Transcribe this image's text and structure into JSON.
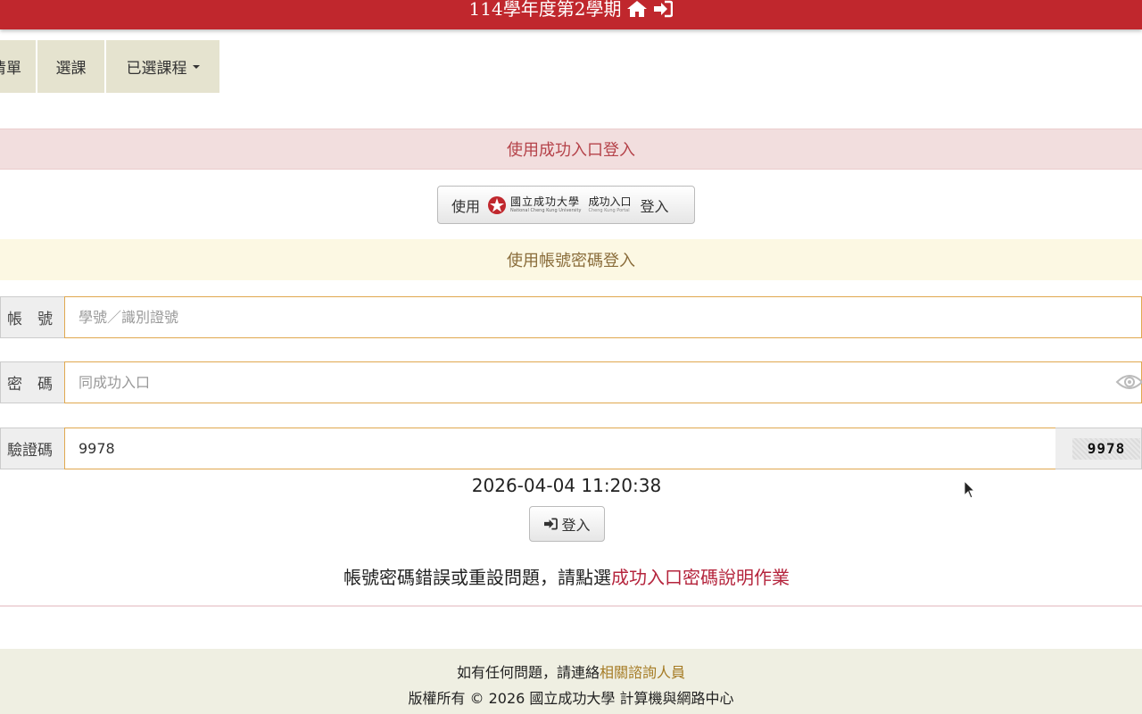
{
  "header": {
    "title": "114學年度第2學期",
    "icons": [
      "home-icon",
      "sign-in-icon"
    ]
  },
  "nav": {
    "items": [
      {
        "label": "清單"
      },
      {
        "label": "選課"
      },
      {
        "label": "已選課程"
      }
    ]
  },
  "sso": {
    "section_title": "使用成功入口登入",
    "button_prefix": "使用",
    "logo_cn": "國立成功大學",
    "logo_en": "National Cheng Kung University",
    "portal_cn": "成功入口",
    "portal_en": "Cheng Kung Portal",
    "button_suffix": "登入"
  },
  "account_login": {
    "section_title": "使用帳號密碼登入",
    "account_label": "帳　號",
    "account_placeholder": "學號／識別證號",
    "password_label": "密　碼",
    "password_placeholder": "同成功入口",
    "captcha_label": "驗證碼",
    "captcha_value": "9978",
    "captcha_image_text": "9978"
  },
  "datetime": "2026-04-04 11:20:38",
  "login_button": "登入",
  "help": {
    "text": "帳號密碼錯誤或重設問題，請點選",
    "link": "成功入口密碼說明作業"
  },
  "footer": {
    "contact_text": "如有任何問題，請連絡",
    "contact_link": "相關諮詢人員",
    "copyright": "版權所有 © 2026 國立成功大學 計算機與網路中心"
  },
  "colors": {
    "header": "#c0272d",
    "nav_bg": "#e5e3cf",
    "sso_band": "#f2dede",
    "account_band": "#fcf8e3",
    "input_border": "#e0a84f",
    "help_link": "#b5253d",
    "footer_bg": "#efefe2"
  }
}
